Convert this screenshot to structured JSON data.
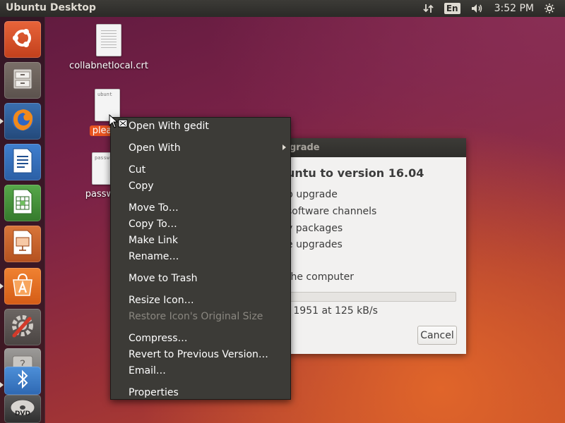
{
  "top_panel": {
    "title": "Ubuntu Desktop",
    "language": "En",
    "clock": "3:52 PM",
    "icons": [
      "network-transfer-icon",
      "volume-icon",
      "power-settings-icon"
    ]
  },
  "launcher": {
    "items": [
      {
        "name": "dash-home",
        "icon": "ubuntu-logo-icon"
      },
      {
        "name": "files",
        "icon": "file-cabinet-icon"
      },
      {
        "name": "firefox",
        "icon": "firefox-icon"
      },
      {
        "name": "libreoffice-writer",
        "icon": "writer-icon"
      },
      {
        "name": "libreoffice-calc",
        "icon": "calc-icon"
      },
      {
        "name": "libreoffice-impress",
        "icon": "impress-icon"
      },
      {
        "name": "software-center",
        "icon": "software-center-icon"
      },
      {
        "name": "system-settings",
        "icon": "settings-icon"
      },
      {
        "name": "help",
        "icon": "help-icon"
      },
      {
        "name": "bluetooth",
        "icon": "bluetooth-icon"
      },
      {
        "name": "dvd",
        "icon": "dvd-icon"
      }
    ]
  },
  "desktop": {
    "files": [
      {
        "label": "collabnetlocal.crt"
      },
      {
        "label": "pleas",
        "thumb_text": "ubunt"
      },
      {
        "label": "passw",
        "thumb_text": "passw"
      }
    ]
  },
  "dialog": {
    "title": "grade",
    "heading": "untu to version 16.04",
    "steps": [
      "p upgrade",
      "software channels",
      "y packages",
      "e upgrades",
      "the computer"
    ],
    "progress_text": "f 1951 at 125 kB/s",
    "progress_fraction": 0.0,
    "cancel_label": "Cancel"
  },
  "context_menu": {
    "items": [
      {
        "label": "Open With gedit"
      },
      {
        "label": "Open With",
        "submenu": true
      },
      {
        "label": "Cut"
      },
      {
        "label": "Copy"
      },
      {
        "label": "Move To…"
      },
      {
        "label": "Copy To…"
      },
      {
        "label": "Make Link"
      },
      {
        "label": "Rename…"
      },
      {
        "label": "Move to Trash"
      },
      {
        "label": "Resize Icon…"
      },
      {
        "label": "Restore Icon's Original Size",
        "disabled": true
      },
      {
        "label": "Compress…"
      },
      {
        "label": "Revert to Previous Version…"
      },
      {
        "label": "Email…"
      },
      {
        "label": "Properties"
      }
    ]
  },
  "colors": {
    "accent": "#e95420",
    "panel": "#3c3b37",
    "menu_bg": "#3c3b37",
    "disabled_text": "#8a8780"
  }
}
